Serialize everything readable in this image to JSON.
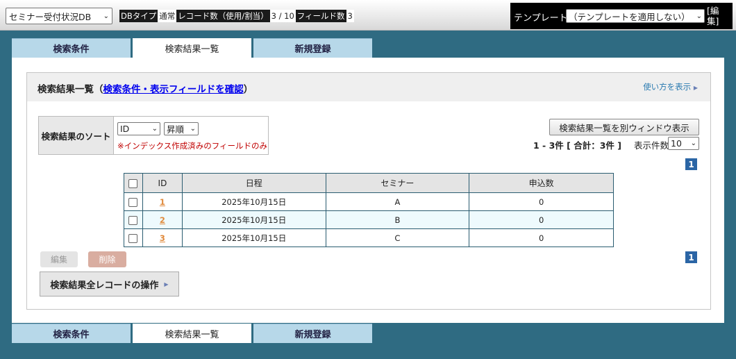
{
  "topbar": {
    "db_select": "セミナー受付状況DB",
    "db_type_label": "DBタイプ",
    "db_type_value": "通常",
    "record_label": "レコード数（使用/割当）",
    "record_value": "3 / 10",
    "field_label": "フィールド数",
    "field_value": "3",
    "template_label": "テンプレート",
    "template_select": "（テンプレートを適用しない）",
    "template_edit": "[編集]"
  },
  "tabs": [
    "検索条件",
    "検索結果一覧",
    "新規登録"
  ],
  "active_tab": "検索結果一覧",
  "main": {
    "title_prefix": "検索結果一覧（",
    "title_link": "検索条件・表示フィールドを確認",
    "title_suffix": "）",
    "howto": "使い方を表示",
    "sort_label": "検索結果のソート",
    "sort_field": "ID",
    "sort_order": "昇順",
    "sort_note": "※インデックス作成済みのフィールドのみ",
    "window_button": "検索結果一覧を別ウィンドウ表示",
    "count_text": "1 - 3件 [ 合計：3件 ]",
    "perpage_label": "表示件数",
    "perpage_value": "10",
    "page_number": "1",
    "edit_button": "編集",
    "delete_button": "削除",
    "all_records_button": "検索結果全レコードの操作"
  },
  "table": {
    "headers": [
      "ID",
      "日程",
      "セミナー",
      "申込数"
    ],
    "rows": [
      {
        "id": "1",
        "date": "2025年10月15日",
        "seminar": "A",
        "count": "0"
      },
      {
        "id": "2",
        "date": "2025年10月15日",
        "seminar": "B",
        "count": "0"
      },
      {
        "id": "3",
        "date": "2025年10月15日",
        "seminar": "C",
        "count": "0"
      }
    ]
  },
  "icons": {
    "dropdown": "chevron-down-icon",
    "arrow": "triangle-right-icon"
  },
  "colors": {
    "background": "#2f6b82",
    "tab_inactive": "#b7d8e9",
    "page_badge": "#2b65a5",
    "note": "#c00000",
    "id_link": "#e08a3c"
  }
}
